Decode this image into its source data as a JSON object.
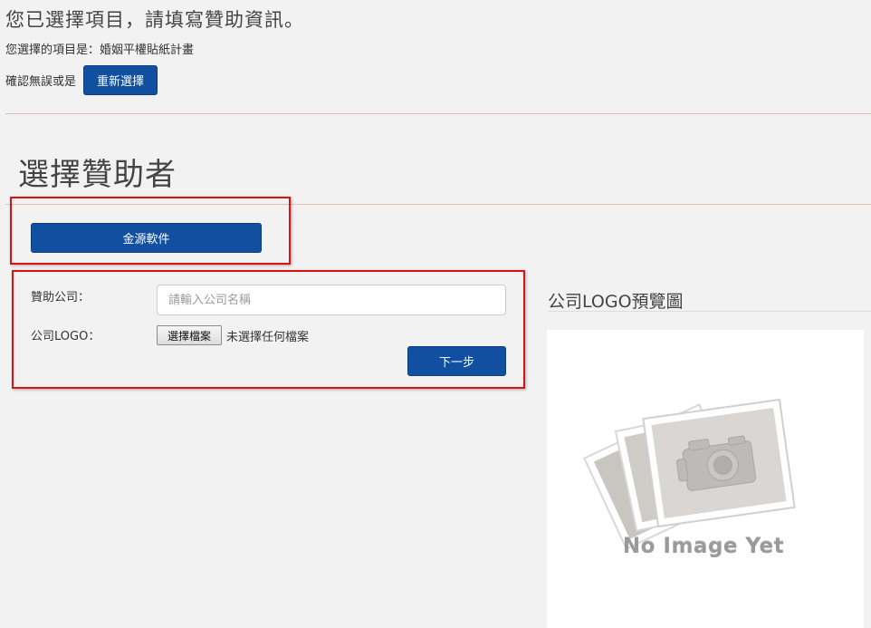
{
  "header": {
    "title": "您已選擇項目，請填寫贊助資訊。",
    "selected_text": "您選擇的項目是：婚姻平權貼紙計畫",
    "confirm_text": "確認無誤或是",
    "reselect_label": "重新選擇"
  },
  "sponsor_section": {
    "title": "選擇贊助者",
    "sponsor_button_label": "金源軟件"
  },
  "form": {
    "company_label": "贊助公司：",
    "company_placeholder": "請輸入公司名稱",
    "company_value": "",
    "logo_label": "公司LOGO：",
    "file_button_label": "選擇檔案",
    "file_status": "未選擇任何檔案",
    "next_label": "下一步"
  },
  "preview": {
    "title": "公司LOGO預覽圖",
    "placeholder_text": "No Image Yet"
  },
  "colors": {
    "primary": "#114fa0",
    "highlight_border": "#dd1111",
    "divider": "#dcc3b2",
    "background": "#f2f2f2"
  }
}
